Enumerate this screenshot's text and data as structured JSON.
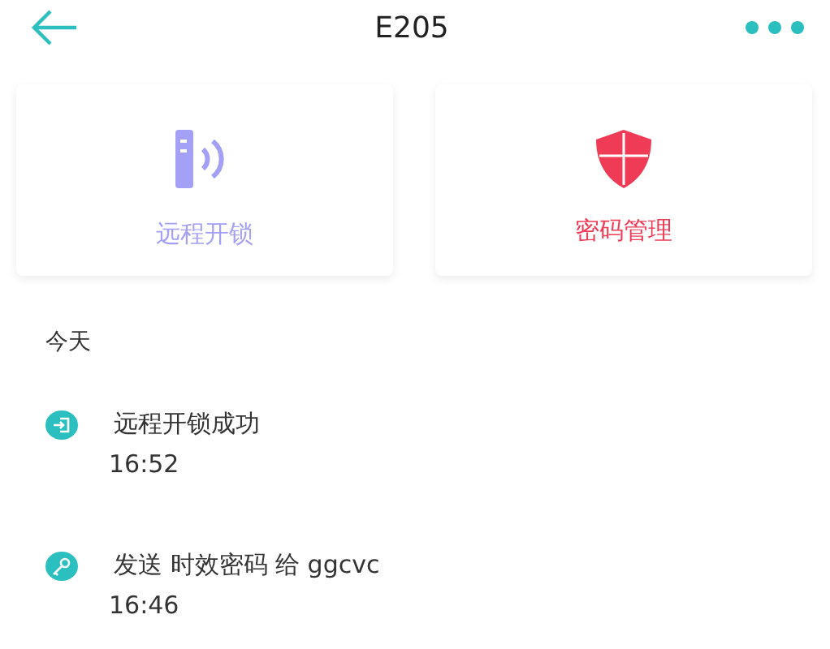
{
  "header": {
    "title": "E205"
  },
  "actions": [
    {
      "kind": "remote",
      "label": "远程开锁",
      "color": "#a3a0f5"
    },
    {
      "kind": "password",
      "label": "密码管理",
      "color": "#ef3b56"
    }
  ],
  "log": {
    "heading": "今天",
    "events": [
      {
        "kind": "unlock",
        "text": "远程开锁成功",
        "time": "16:52"
      },
      {
        "kind": "key",
        "text": "发送 时效密码 给 ggcvc",
        "time": "16:46"
      }
    ]
  }
}
